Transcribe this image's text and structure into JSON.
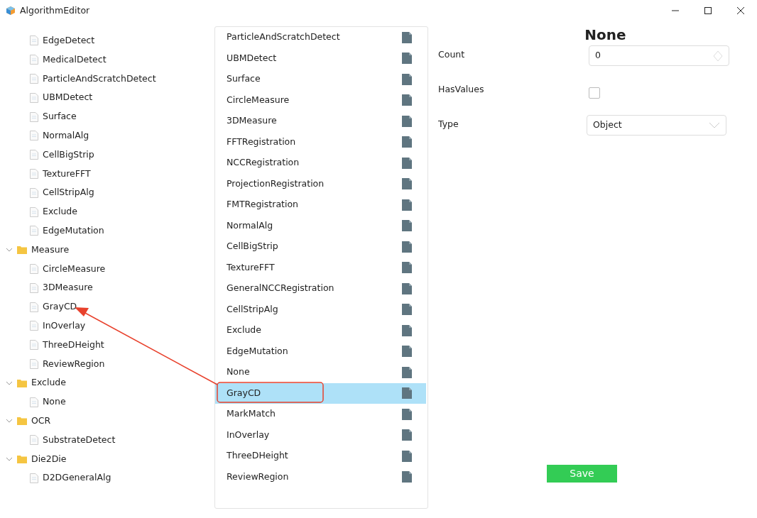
{
  "window": {
    "title": "AlgorithmEditor"
  },
  "tree": [
    {
      "kind": "group-continued",
      "children": [
        {
          "label": "EdgeDetect"
        },
        {
          "label": "MedicalDetect"
        },
        {
          "label": "ParticleAndScratchDetect"
        },
        {
          "label": "UBMDetect"
        },
        {
          "label": "Surface"
        },
        {
          "label": "NormalAlg"
        },
        {
          "label": "CellBigStrip"
        },
        {
          "label": "TextureFFT"
        },
        {
          "label": "CellStripAlg"
        },
        {
          "label": "Exclude"
        },
        {
          "label": "EdgeMutation"
        }
      ]
    },
    {
      "kind": "folder",
      "label": "Measure",
      "expanded": true,
      "children": [
        {
          "label": "CircleMeasure"
        },
        {
          "label": "3DMeasure"
        },
        {
          "label": "GrayCD"
        },
        {
          "label": "InOverlay"
        },
        {
          "label": "ThreeDHeight"
        },
        {
          "label": "ReviewRegion"
        }
      ]
    },
    {
      "kind": "folder",
      "label": "Exclude",
      "expanded": true,
      "children": [
        {
          "label": "None"
        }
      ]
    },
    {
      "kind": "folder",
      "label": "OCR",
      "expanded": true,
      "children": [
        {
          "label": "SubstrateDetect"
        }
      ]
    },
    {
      "kind": "folder",
      "label": "Die2Die",
      "expanded": true,
      "children": [
        {
          "label": "D2DGeneralAlg"
        }
      ]
    }
  ],
  "algorithm_list": [
    {
      "label": "ParticleAndScratchDetect",
      "selected": false
    },
    {
      "label": "UBMDetect",
      "selected": false
    },
    {
      "label": "Surface",
      "selected": false
    },
    {
      "label": "CircleMeasure",
      "selected": false
    },
    {
      "label": "3DMeasure",
      "selected": false
    },
    {
      "label": "FFTRegistration",
      "selected": false
    },
    {
      "label": "NCCRegistration",
      "selected": false
    },
    {
      "label": "ProjectionRegistration",
      "selected": false
    },
    {
      "label": "FMTRegistration",
      "selected": false
    },
    {
      "label": "NormalAlg",
      "selected": false
    },
    {
      "label": "CellBigStrip",
      "selected": false
    },
    {
      "label": "TextureFFT",
      "selected": false
    },
    {
      "label": "GeneralNCCRegistration",
      "selected": false
    },
    {
      "label": "CellStripAlg",
      "selected": false
    },
    {
      "label": "Exclude",
      "selected": false
    },
    {
      "label": "EdgeMutation",
      "selected": false
    },
    {
      "label": "None",
      "selected": false
    },
    {
      "label": "GrayCD",
      "selected": true
    },
    {
      "label": "MarkMatch",
      "selected": false
    },
    {
      "label": "InOverlay",
      "selected": false
    },
    {
      "label": "ThreeDHeight",
      "selected": false
    },
    {
      "label": "ReviewRegion",
      "selected": false
    }
  ],
  "properties": {
    "title": "None",
    "fields": [
      {
        "kind": "number",
        "label": "Count",
        "value": "0"
      },
      {
        "kind": "checkbox",
        "label": "HasValues",
        "checked": false
      },
      {
        "kind": "select",
        "label": "Type",
        "value": "Object"
      }
    ]
  },
  "save_button": "Save"
}
